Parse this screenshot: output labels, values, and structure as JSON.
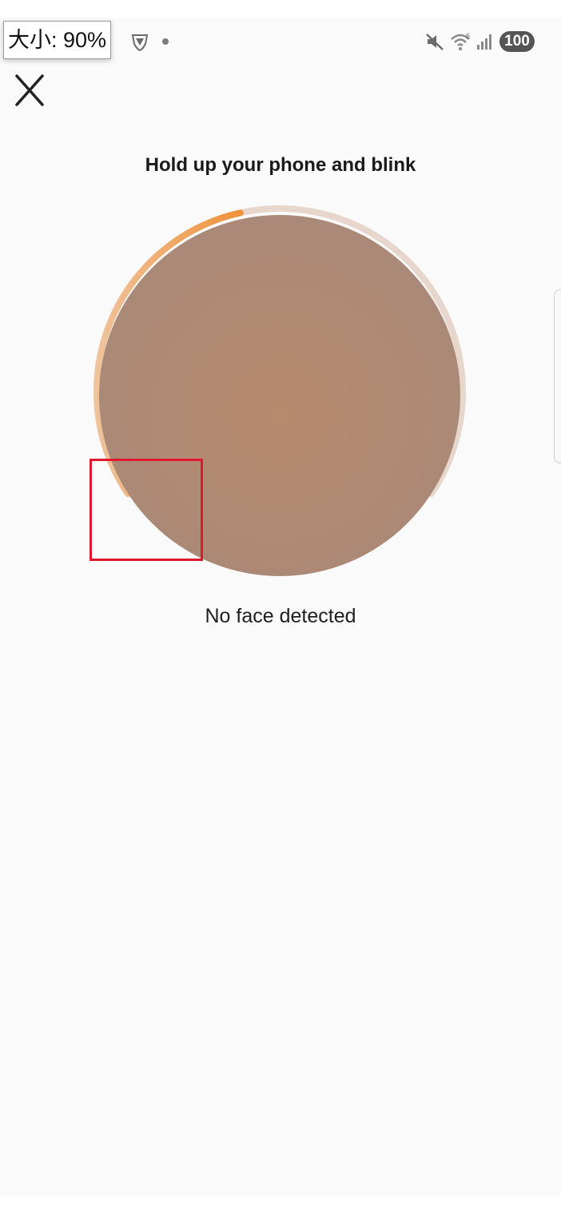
{
  "status_bar": {
    "size_indicator": "大小: 90%",
    "battery": "100",
    "icons": [
      "vpn-shield-icon",
      "notification-dot-icon",
      "mute-icon",
      "wifi-icon",
      "signal-icon",
      "battery-icon"
    ]
  },
  "header": {
    "close_icon": "close-icon"
  },
  "liveness": {
    "instruction": "Hold up your phone and blink",
    "status": "No face detected",
    "progress_fraction": 0.45,
    "colors": {
      "progress_start": "#efc39c",
      "progress_end": "#f0923a",
      "track": "#e6d6cc",
      "camera_fill": "#b0896f"
    }
  },
  "annotation": {
    "highlight_color": "#e0192f"
  }
}
